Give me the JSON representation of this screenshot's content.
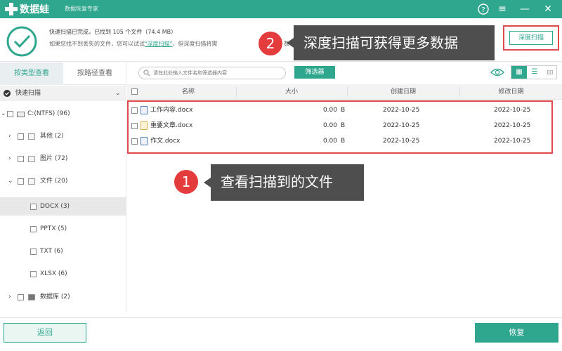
{
  "titlebar": {
    "app_name": "数据蛙",
    "app_subtitle": "数据恢复专家",
    "help": "?",
    "menu": "≡",
    "minimize": "—",
    "close": "✕"
  },
  "status": {
    "line1": "快速扫描已完成，已找到 105 个文件（74.4 MB）",
    "line2_prefix": "如果您找不到丢失的文件，您可以试试",
    "line2_link": "\"深度扫描\"",
    "line2_suffix": "，但深度扫描将需",
    "line2_tail": "数",
    "deep_scan_button": "深度扫描"
  },
  "annotations": {
    "badge1": "1",
    "tip1": "查看扫描到的文件",
    "badge2": "2",
    "tip2": "深度扫描可获得更多数据"
  },
  "sidebar": {
    "tabs": [
      "按类型查看",
      "按路径查看"
    ],
    "quick_scan": "快速扫描",
    "tree": [
      {
        "label": "C:(NTFS) (96)"
      },
      {
        "label": "其他 (2)"
      },
      {
        "label": "图片 (72)"
      },
      {
        "label": "文件 (20)"
      },
      {
        "label": "DOCX (3)"
      },
      {
        "label": "PPTX (5)"
      },
      {
        "label": "TXT (6)"
      },
      {
        "label": "XLSX (6)"
      },
      {
        "label": "数据库 (2)"
      }
    ]
  },
  "toolbar": {
    "search_placeholder": "请在此处输入文件名和筛选器内容",
    "filter_button": "筛选器",
    "view_grid": "▦",
    "view_list": "☰",
    "view_detail": "▯▯"
  },
  "table": {
    "headers": [
      "名称",
      "大小",
      "创建日期",
      "修改日期"
    ],
    "rows": [
      {
        "name": "工作内容.docx",
        "size": "0.00",
        "unit": "B",
        "created": "2022-10-25",
        "modified": "2022-10-25"
      },
      {
        "name": "重要文章.docx",
        "size": "0.00",
        "unit": "B",
        "created": "2022-10-25",
        "modified": "2022-10-25"
      },
      {
        "name": "作文.docx",
        "size": "0.00",
        "unit": "B",
        "created": "2022-10-25",
        "modified": "2022-10-25"
      }
    ]
  },
  "bottom": {
    "back": "返回",
    "recover": "恢复"
  },
  "colors": {
    "brand": "#2fa68e",
    "highlight": "#e14a4a",
    "tooltip": "#4e4e4e"
  }
}
